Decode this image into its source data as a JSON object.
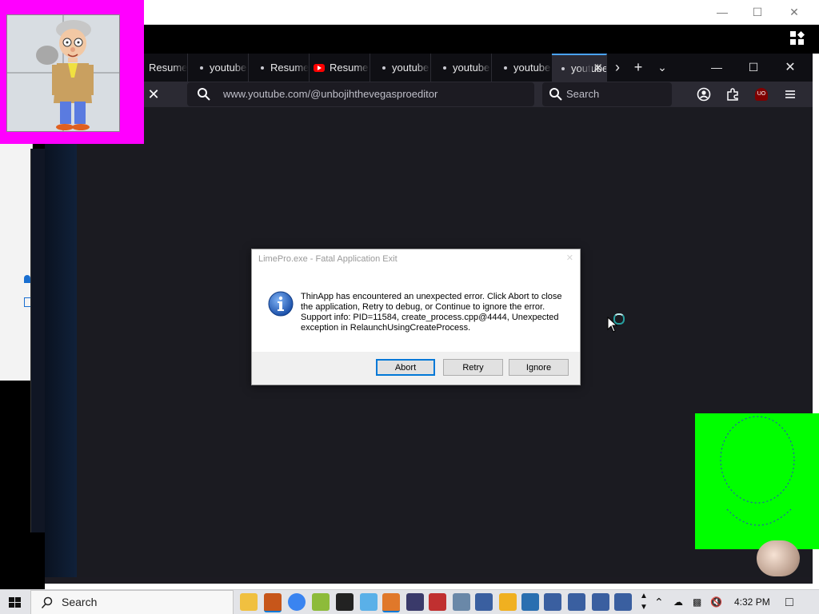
{
  "browser": {
    "tabs": [
      {
        "label": "Resume",
        "kind": "text"
      },
      {
        "label": "youtube",
        "kind": "dot"
      },
      {
        "label": "Resume",
        "kind": "dot"
      },
      {
        "label": "Resume",
        "kind": "yt"
      },
      {
        "label": "youtube",
        "kind": "dot"
      },
      {
        "label": "youtube",
        "kind": "dot"
      },
      {
        "label": "youtube",
        "kind": "dot"
      },
      {
        "label": "youtube",
        "kind": "dot-active"
      }
    ],
    "url": "www.youtube.com/@unbojihthevegasproeditor",
    "search_placeholder": "Search",
    "ublock_label": "UO"
  },
  "dialog": {
    "title": "LimePro.exe - Fatal Application Exit",
    "message": "ThinApp has encountered an unexpected error. Click Abort to close the application, Retry to debug, or Continue to ignore the error. Support info: PID=11584, create_process.cpp@4444, Unexpected exception in RelaunchUsingCreateProcess.",
    "buttons": {
      "abort": "Abort",
      "retry": "Retry",
      "ignore": "Ignore"
    }
  },
  "taskbar": {
    "search_label": "Search",
    "clock": "4:32 PM",
    "apps": [
      "file-explorer",
      "firefox",
      "chrome",
      "app-green",
      "terminal",
      "notepad",
      "calculator",
      "app-wave",
      "app-red",
      "app-network",
      "app-gear-1",
      "app-media",
      "app-window",
      "app-gear-2",
      "app-gear-3",
      "app-gear-4",
      "app-gear-5"
    ]
  },
  "colors": {
    "accent": "#0078d7",
    "overlay_pink": "#ff00ff",
    "overlay_green": "#00ff00",
    "ff_background": "#1c1b22"
  }
}
